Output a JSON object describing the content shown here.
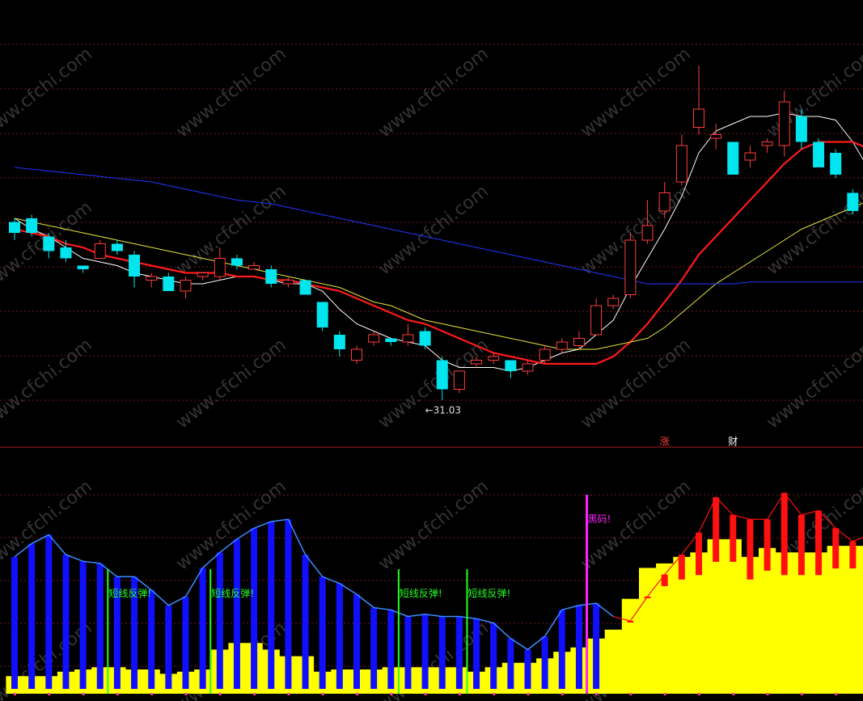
{
  "colors": {
    "background": "#000000",
    "up_candle": "#ff3c3c",
    "down_candle": "#00e5ee",
    "ma5": "#ffffff",
    "ma10": "#ff1a1a",
    "ma20": "#e6e640",
    "ma60": "#2236ff",
    "indicator_line": "#3b8cff",
    "blue_bar": "#1010ff",
    "red_bar": "#ff1010",
    "yellow_area": "#ffff00",
    "signal_green": "#22ff22",
    "signal_magenta": "#ff22ff",
    "divider": "#b01818",
    "grid": "#7a1a1a"
  },
  "watermark": "www.cfchi.com",
  "chart_data": [
    {
      "type": "candlestick",
      "price_range": [
        30.0,
        40.0
      ],
      "low_marker": {
        "label": "←31.03",
        "value": 31.03,
        "bar_index": 24
      },
      "candles": [
        {
          "o": 35.9,
          "c": 35.6,
          "h": 36.0,
          "l": 35.4
        },
        {
          "o": 36.0,
          "c": 35.6,
          "h": 36.1,
          "l": 35.5
        },
        {
          "o": 35.5,
          "c": 35.1,
          "h": 35.6,
          "l": 34.9
        },
        {
          "o": 35.2,
          "c": 34.9,
          "h": 35.4,
          "l": 34.8
        },
        {
          "o": 34.7,
          "c": 34.6,
          "h": 34.7,
          "l": 34.5
        },
        {
          "o": 34.9,
          "c": 35.3,
          "h": 35.4,
          "l": 34.9
        },
        {
          "o": 35.3,
          "c": 35.1,
          "h": 35.4,
          "l": 35.0
        },
        {
          "o": 35.0,
          "c": 34.4,
          "h": 35.1,
          "l": 34.1
        },
        {
          "o": 34.3,
          "c": 34.4,
          "h": 34.5,
          "l": 34.1
        },
        {
          "o": 34.4,
          "c": 34.0,
          "h": 34.5,
          "l": 34.0
        },
        {
          "o": 34.0,
          "c": 34.3,
          "h": 34.4,
          "l": 33.8
        },
        {
          "o": 34.4,
          "c": 34.5,
          "h": 34.5,
          "l": 34.3
        },
        {
          "o": 34.4,
          "c": 34.9,
          "h": 35.2,
          "l": 34.3
        },
        {
          "o": 34.9,
          "c": 34.7,
          "h": 35.0,
          "l": 34.6
        },
        {
          "o": 34.6,
          "c": 34.7,
          "h": 34.8,
          "l": 34.6
        },
        {
          "o": 34.6,
          "c": 34.2,
          "h": 34.7,
          "l": 34.1
        },
        {
          "o": 34.2,
          "c": 34.3,
          "h": 34.4,
          "l": 34.1
        },
        {
          "o": 34.3,
          "c": 33.9,
          "h": 34.3,
          "l": 33.9
        },
        {
          "o": 33.7,
          "c": 33.0,
          "h": 33.7,
          "l": 32.9
        },
        {
          "o": 32.8,
          "c": 32.4,
          "h": 32.9,
          "l": 32.2
        },
        {
          "o": 32.1,
          "c": 32.4,
          "h": 32.5,
          "l": 32.0
        },
        {
          "o": 32.6,
          "c": 32.8,
          "h": 32.9,
          "l": 32.5
        },
        {
          "o": 32.7,
          "c": 32.6,
          "h": 32.7,
          "l": 32.5
        },
        {
          "o": 32.6,
          "c": 32.8,
          "h": 33.1,
          "l": 32.5
        },
        {
          "o": 32.9,
          "c": 32.5,
          "h": 33.0,
          "l": 32.4
        },
        {
          "o": 32.1,
          "c": 31.3,
          "h": 32.2,
          "l": 31.0
        },
        {
          "o": 31.3,
          "c": 31.8,
          "h": 31.8,
          "l": 31.2
        },
        {
          "o": 32.0,
          "c": 32.1,
          "h": 32.2,
          "l": 31.9
        },
        {
          "o": 32.1,
          "c": 32.2,
          "h": 32.3,
          "l": 32.0
        },
        {
          "o": 32.1,
          "c": 31.8,
          "h": 32.1,
          "l": 31.6
        },
        {
          "o": 31.8,
          "c": 32.0,
          "h": 32.1,
          "l": 31.7
        },
        {
          "o": 32.1,
          "c": 32.4,
          "h": 32.5,
          "l": 32.0
        },
        {
          "o": 32.4,
          "c": 32.6,
          "h": 32.7,
          "l": 32.3
        },
        {
          "o": 32.5,
          "c": 32.7,
          "h": 32.9,
          "l": 32.4
        },
        {
          "o": 32.8,
          "c": 33.6,
          "h": 33.8,
          "l": 32.8
        },
        {
          "o": 33.6,
          "c": 33.8,
          "h": 33.9,
          "l": 33.5
        },
        {
          "o": 33.9,
          "c": 35.4,
          "h": 35.6,
          "l": 33.8
        },
        {
          "o": 35.4,
          "c": 35.8,
          "h": 36.5,
          "l": 35.3
        },
        {
          "o": 36.2,
          "c": 36.7,
          "h": 37.0,
          "l": 36.0
        },
        {
          "o": 37.0,
          "c": 38.0,
          "h": 38.3,
          "l": 36.9
        },
        {
          "o": 38.5,
          "c": 39.0,
          "h": 40.2,
          "l": 38.3
        },
        {
          "o": 38.2,
          "c": 38.3,
          "h": 38.6,
          "l": 37.9
        },
        {
          "o": 38.1,
          "c": 37.2,
          "h": 38.1,
          "l": 37.2
        },
        {
          "o": 37.6,
          "c": 37.8,
          "h": 38.0,
          "l": 37.4
        },
        {
          "o": 38.0,
          "c": 38.1,
          "h": 38.2,
          "l": 37.8
        },
        {
          "o": 38.0,
          "c": 39.2,
          "h": 39.5,
          "l": 37.7
        },
        {
          "o": 38.8,
          "c": 38.1,
          "h": 39.0,
          "l": 37.9
        },
        {
          "o": 38.1,
          "c": 37.4,
          "h": 38.2,
          "l": 37.4
        },
        {
          "o": 37.8,
          "c": 37.2,
          "h": 37.9,
          "l": 37.1
        },
        {
          "o": 36.7,
          "c": 36.2,
          "h": 36.8,
          "l": 36.1
        },
        {
          "o": 36.1,
          "c": 36.4,
          "h": 36.6,
          "l": 35.9
        },
        {
          "o": 36.2,
          "c": 35.7,
          "h": 36.3,
          "l": 35.6
        }
      ],
      "series": [
        {
          "name": "",
          "color_key": "ma5",
          "width": 1,
          "y": [
            36.0,
            35.7,
            35.5,
            35.2,
            34.9,
            34.8,
            34.7,
            34.5,
            34.4,
            34.3,
            34.2,
            34.2,
            34.3,
            34.4,
            34.4,
            34.3,
            34.2,
            34.2,
            34.0,
            33.5,
            33.1,
            32.9,
            32.7,
            32.6,
            32.5,
            32.1,
            31.9,
            31.9,
            31.9,
            31.8,
            31.9,
            32.1,
            32.3,
            32.4,
            32.8,
            33.2,
            34.1,
            34.9,
            35.7,
            36.6,
            37.8,
            38.4,
            38.6,
            38.8,
            38.8,
            38.9,
            38.8,
            38.8,
            38.7,
            38.1,
            37.3,
            36.8
          ]
        },
        {
          "name": "",
          "color_key": "ma10",
          "width": 2.2,
          "y": [
            35.7,
            35.6,
            35.5,
            35.3,
            35.2,
            35.0,
            34.9,
            34.8,
            34.7,
            34.6,
            34.5,
            34.5,
            34.5,
            34.4,
            34.4,
            34.3,
            34.3,
            34.2,
            34.1,
            34.0,
            33.8,
            33.6,
            33.4,
            33.2,
            33.1,
            32.9,
            32.7,
            32.5,
            32.3,
            32.2,
            32.1,
            32.0,
            32.0,
            32.0,
            32.0,
            32.2,
            32.6,
            33.1,
            33.7,
            34.3,
            35.0,
            35.5,
            36.0,
            36.5,
            37.0,
            37.5,
            37.9,
            38.1,
            38.1,
            38.1,
            37.9,
            37.6
          ]
        },
        {
          "name": "",
          "color_key": "ma20",
          "width": 1,
          "y": [
            36.0,
            35.9,
            35.8,
            35.7,
            35.6,
            35.5,
            35.4,
            35.3,
            35.2,
            35.1,
            35.0,
            34.9,
            34.8,
            34.7,
            34.6,
            34.5,
            34.4,
            34.3,
            34.2,
            34.1,
            33.9,
            33.7,
            33.6,
            33.4,
            33.2,
            33.1,
            33.0,
            32.9,
            32.8,
            32.7,
            32.6,
            32.5,
            32.4,
            32.4,
            32.4,
            32.5,
            32.6,
            32.7,
            33.0,
            33.4,
            33.8,
            34.2,
            34.5,
            34.8,
            35.1,
            35.4,
            35.7,
            35.9,
            36.1,
            36.3,
            36.5,
            36.6
          ]
        },
        {
          "name": "",
          "color_key": "ma60",
          "width": 1,
          "y": [
            37.4,
            37.35,
            37.3,
            37.25,
            37.2,
            37.15,
            37.1,
            37.05,
            37.0,
            36.9,
            36.8,
            36.7,
            36.6,
            36.5,
            36.45,
            36.4,
            36.3,
            36.2,
            36.1,
            36.0,
            35.9,
            35.8,
            35.7,
            35.6,
            35.5,
            35.4,
            35.3,
            35.2,
            35.1,
            35.0,
            34.9,
            34.8,
            34.7,
            34.6,
            34.5,
            34.4,
            34.3,
            34.2,
            34.2,
            34.2,
            34.2,
            34.2,
            34.2,
            34.25,
            34.25,
            34.25,
            34.25,
            34.25,
            34.25,
            34.25,
            34.25,
            34.25
          ]
        }
      ],
      "markers": [
        {
          "text": "涨",
          "bar_index": 38,
          "color_key": "up_candle"
        },
        {
          "text": "财",
          "bar_index": 42,
          "color_key": "ma5"
        }
      ]
    },
    {
      "type": "bar",
      "range": [
        0,
        100
      ],
      "series": [
        {
          "name": "",
          "color_key": "indicator_line",
          "values": [
            62,
            68,
            72,
            63,
            60,
            59,
            53,
            53,
            47,
            40,
            44,
            57,
            64,
            70,
            75,
            78,
            79,
            63,
            53,
            50,
            45,
            39,
            38,
            35,
            36,
            35,
            35,
            34,
            32,
            25,
            20,
            26,
            38,
            40,
            41,
            35,
            33,
            44,
            54,
            63,
            73,
            89,
            81,
            79,
            79,
            91,
            81,
            83,
            75,
            69,
            72,
            74
          ]
        },
        {
          "name": "",
          "color_key": "yellow_area",
          "values": [
            8,
            8,
            8,
            10,
            11,
            12,
            12,
            11,
            11,
            9,
            10,
            11,
            20,
            23,
            23,
            20,
            17,
            17,
            10,
            11,
            11,
            11,
            12,
            12,
            12,
            12,
            12,
            10,
            12,
            14,
            14,
            16,
            19,
            21,
            25,
            29,
            43,
            57,
            59,
            62,
            64,
            70,
            70,
            62,
            66,
            64,
            64,
            64,
            67,
            67,
            67,
            68
          ]
        }
      ],
      "bar_colors": [
        "blue",
        "blue",
        "blue",
        "blue",
        "blue",
        "blue",
        "blue",
        "blue",
        "blue",
        "blue",
        "blue",
        "blue",
        "blue",
        "blue",
        "blue",
        "blue",
        "blue",
        "blue",
        "blue",
        "blue",
        "blue",
        "blue",
        "blue",
        "blue",
        "blue",
        "blue",
        "blue",
        "blue",
        "blue",
        "blue",
        "blue",
        "blue",
        "blue",
        "blue",
        "blue",
        "yellow",
        "red",
        "red",
        "red",
        "red",
        "red",
        "red",
        "red",
        "red",
        "red",
        "red",
        "red",
        "red",
        "red",
        "red",
        "red",
        "blue"
      ],
      "signals": [
        {
          "bar_index": 6,
          "label": "短线反弹!",
          "color_key": "signal_green"
        },
        {
          "bar_index": 12,
          "label": "短线反弹!",
          "color_key": "signal_green"
        },
        {
          "bar_index": 23,
          "label": "短线反弹!",
          "color_key": "signal_green"
        },
        {
          "bar_index": 27,
          "label": "短线反弹!",
          "color_key": "signal_green"
        },
        {
          "bar_index": 34,
          "label": "黑码!",
          "color_key": "signal_magenta"
        }
      ]
    }
  ]
}
